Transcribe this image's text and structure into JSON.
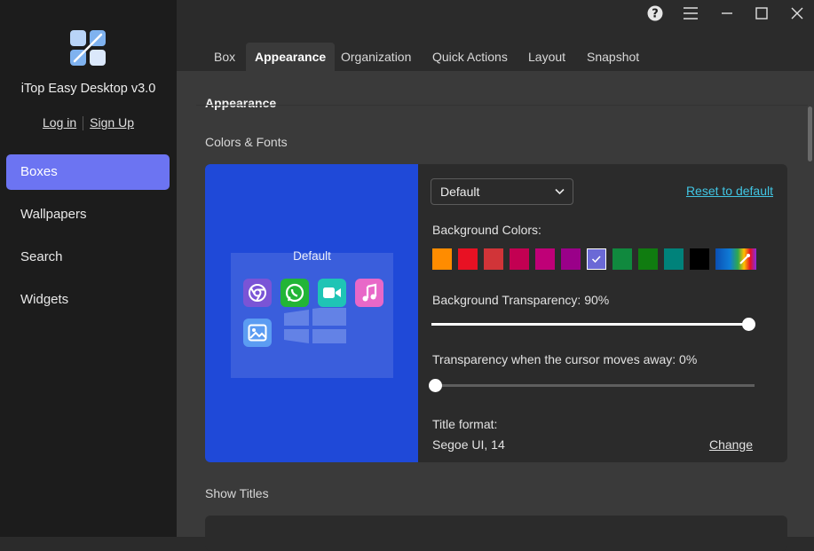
{
  "app": {
    "title": "iTop Easy Desktop v3.0",
    "login": "Log in",
    "signup": "Sign Up"
  },
  "nav": [
    "Boxes",
    "Wallpapers",
    "Search",
    "Widgets"
  ],
  "window_controls": [
    "help-icon",
    "menu-icon",
    "minimize-icon",
    "maximize-icon",
    "close-icon"
  ],
  "tabs": [
    "Box",
    "Appearance",
    "Organization",
    "Quick Actions",
    "Layout",
    "Snapshot"
  ],
  "active_tab": "Appearance",
  "section": {
    "title": "Appearance",
    "colors_fonts": "Colors & Fonts",
    "show_titles": "Show Titles"
  },
  "preview": {
    "box_title": "Default",
    "icons": [
      "chrome-icon",
      "whatsapp-icon",
      "facetime-icon",
      "music-icon",
      "photos-icon"
    ]
  },
  "theme": {
    "selected": "Default",
    "reset": "Reset to default"
  },
  "background_colors": {
    "label": "Background Colors:",
    "swatches": [
      "#ff8c00",
      "#e81123",
      "#d13438",
      "#c30052",
      "#bf0077",
      "#9a0089",
      "#6b69d6",
      "#10893e",
      "#107c10",
      "#00827a",
      "#000000",
      "custom"
    ],
    "selected_index": 6,
    "accent": "#6c74f2"
  },
  "bg_transparency": {
    "label": "Background Transparency: 90%",
    "value": 90
  },
  "cursor_transparency": {
    "label": "Transparency when the cursor moves away: 0%",
    "value": 0
  },
  "title_format": {
    "label": "Title format:",
    "value": "Segoe UI, 14",
    "change": "Change"
  }
}
